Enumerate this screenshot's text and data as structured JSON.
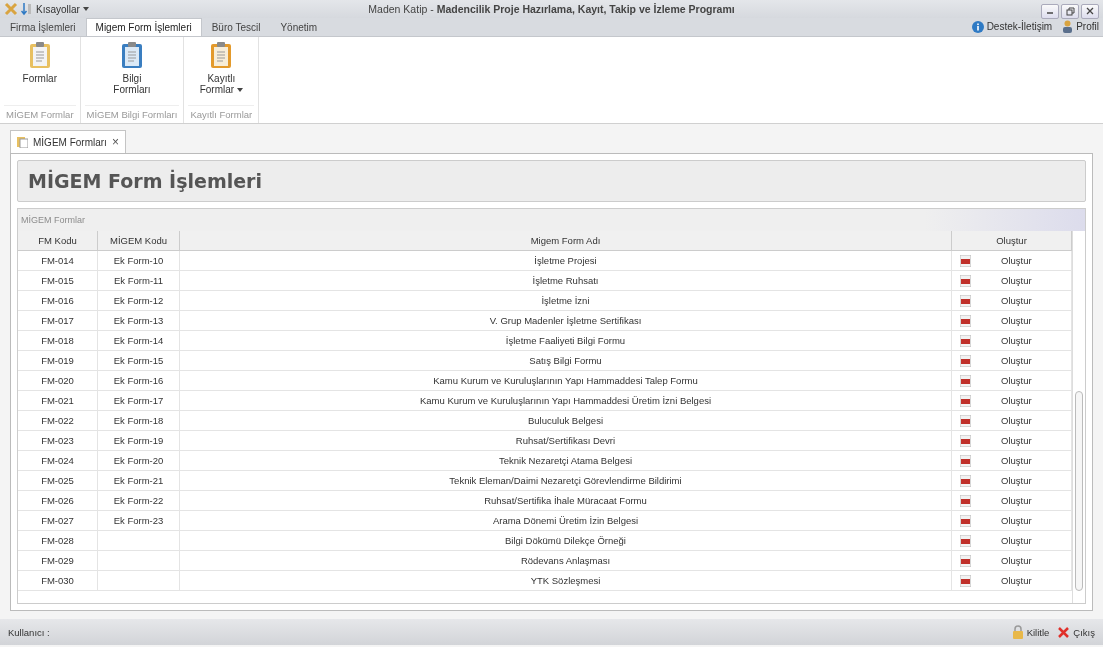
{
  "window": {
    "title": "Maden Katip - **Madencilik Proje Hazırlama, Kayıt, Takip ve İzleme Programı**"
  },
  "quick_access": {
    "label": "Kısayollar"
  },
  "ribbon_tabs": [
    {
      "label": "Firma İşlemleri",
      "selected": false
    },
    {
      "label": "Migem Form İşlemleri",
      "selected": true
    },
    {
      "label": "Büro Tescil",
      "selected": false
    },
    {
      "label": "Yönetim",
      "selected": false
    }
  ],
  "top_right": [
    {
      "kind": "info",
      "label": "Destek-İletişim"
    },
    {
      "kind": "user",
      "label": "Profil"
    }
  ],
  "ribbon_groups": [
    {
      "caption": "MİGEM Formlar",
      "button": {
        "kind": "plain",
        "label": "Formlar",
        "dropdown": false
      }
    },
    {
      "caption": "MİGEM Bilgi Formları",
      "button": {
        "kind": "blue",
        "label": "Bilgi Formları",
        "dropdown": false
      }
    },
    {
      "caption": "Kayıtlı Formlar",
      "button": {
        "kind": "orange",
        "label": "Kayıtlı Formlar",
        "dropdown": true
      }
    }
  ],
  "document_tab": {
    "label": "MİGEM Formları",
    "close": "×"
  },
  "page_title": "MİGEM Form İşlemleri",
  "group_caption": "MİGEM Formlar",
  "table": {
    "columns": [
      "FM Kodu",
      "MİGEM Kodu",
      "Migem Form Adı",
      "Oluştur"
    ],
    "rows": [
      [
        "FM-014",
        "Ek Form-10",
        "İşletme Projesi",
        "Oluştur"
      ],
      [
        "FM-015",
        "Ek Form-11",
        "İşletme Ruhsatı",
        "Oluştur"
      ],
      [
        "FM-016",
        "Ek Form-12",
        "İşletme İzni",
        "Oluştur"
      ],
      [
        "FM-017",
        "Ek Form-13",
        "V. Grup Madenler İşletme Sertifikası",
        "Oluştur"
      ],
      [
        "FM-018",
        "Ek Form-14",
        "İşletme Faaliyeti Bilgi Formu",
        "Oluştur"
      ],
      [
        "FM-019",
        "Ek Form-15",
        "Satış Bilgi Formu",
        "Oluştur"
      ],
      [
        "FM-020",
        "Ek Form-16",
        "Kamu Kurum ve Kuruluşlarının Yapı Hammaddesi Talep Formu",
        "Oluştur"
      ],
      [
        "FM-021",
        "Ek Form-17",
        "Kamu Kurum ve Kuruluşlarının Yapı Hammaddesi Üretim İzni Belgesi",
        "Oluştur"
      ],
      [
        "FM-022",
        "Ek Form-18",
        "Buluculuk Belgesi",
        "Oluştur"
      ],
      [
        "FM-023",
        "Ek Form-19",
        "Ruhsat/Sertifikası Devri",
        "Oluştur"
      ],
      [
        "FM-024",
        "Ek Form-20",
        "Teknik Nezaretçi Atama Belgesi",
        "Oluştur"
      ],
      [
        "FM-025",
        "Ek Form-21",
        "Teknik Eleman/Daimi Nezaretçi Görevlendirme Bildirimi",
        "Oluştur"
      ],
      [
        "FM-026",
        "Ek Form-22",
        "Ruhsat/Sertifika İhale Müracaat Formu",
        "Oluştur"
      ],
      [
        "FM-027",
        "Ek Form-23",
        "Arama Dönemi Üretim İzin Belgesi",
        "Oluştur"
      ],
      [
        "FM-028",
        "",
        "Bilgi Dökümü Dilekçe Örneği",
        "Oluştur"
      ],
      [
        "FM-029",
        "",
        "Rödevans Anlaşması",
        "Oluştur"
      ],
      [
        "FM-030",
        "",
        "YTK Sözleşmesi",
        "Oluştur"
      ]
    ]
  },
  "status_bar": {
    "user_label": "Kullanıcı :",
    "actions": [
      {
        "kind": "lock",
        "label": "Kilitle"
      },
      {
        "kind": "exit",
        "label": "Çıkış"
      }
    ]
  }
}
